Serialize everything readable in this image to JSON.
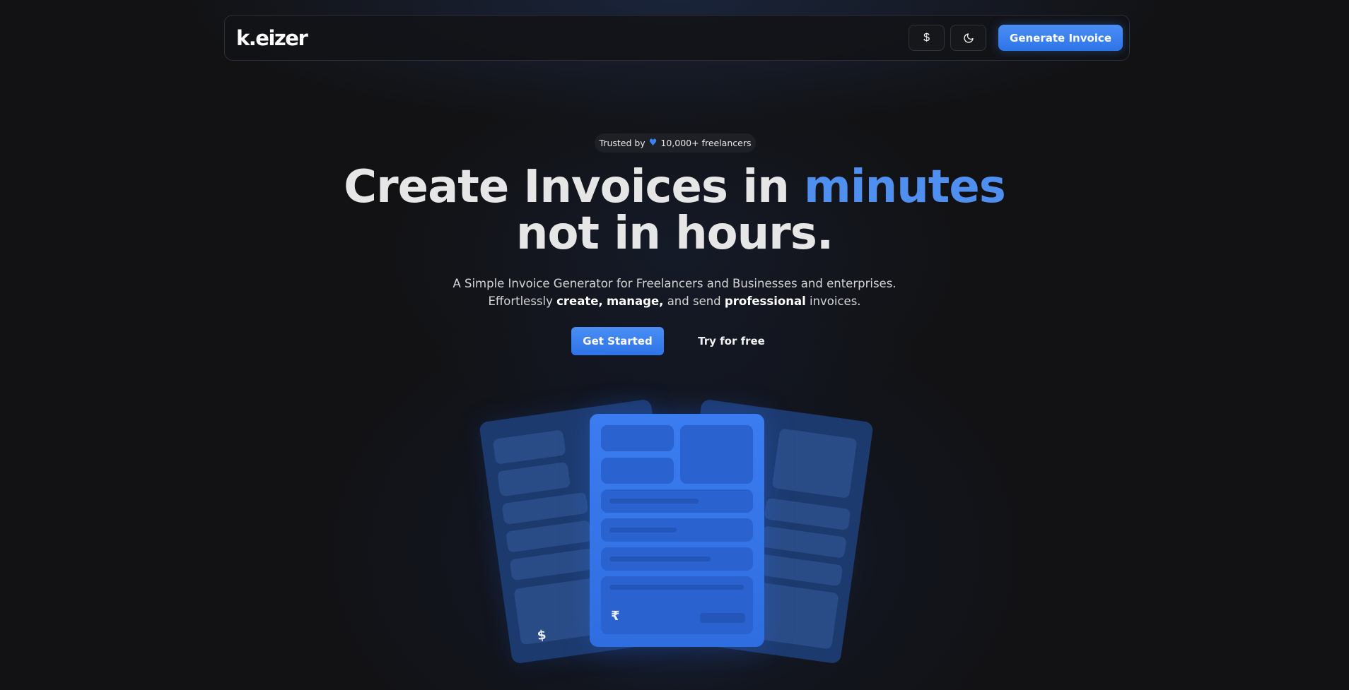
{
  "header": {
    "logo_text": "k.eizer",
    "currency_icon": "dollar-icon",
    "theme_icon": "moon-icon",
    "generate_label": "Generate Invoice"
  },
  "hero": {
    "trusted_prefix": "Trusted by",
    "trusted_icon": "heart-icon",
    "trusted_suffix": "10,000+ freelancers",
    "headline_part1": "Create Invoices in",
    "headline_accent": "minutes",
    "headline_line2": "not in hours.",
    "subtitle_line1": "A Simple Invoice Generator for Freelancers and Businesses and enterprises.",
    "subtitle_pre": "Effortlessly",
    "subtitle_create": "create,",
    "subtitle_manage": "manage,",
    "subtitle_mid": "and send",
    "subtitle_professional": "professional",
    "subtitle_post": "invoices.",
    "get_started_label": "Get Started",
    "try_free_label": "Try for free"
  },
  "illustration": {
    "left_currency": "$",
    "center_currency": "₹"
  },
  "colors": {
    "accent": "#3b82f6",
    "background": "#121214",
    "card": "#2f6ee0"
  }
}
